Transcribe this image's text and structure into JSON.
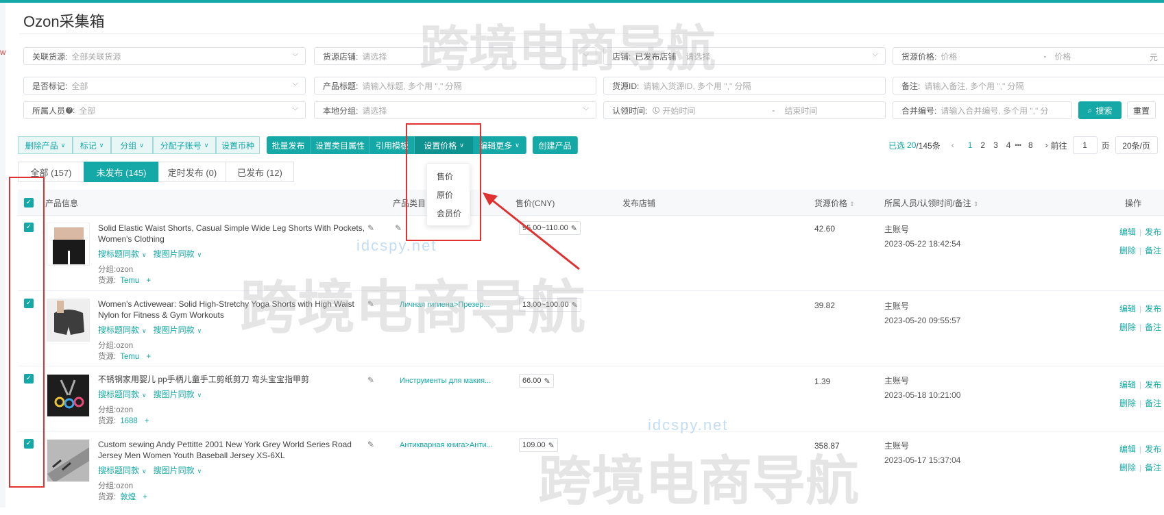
{
  "app": {
    "title": "Ozon采集箱",
    "side_mark": "W"
  },
  "filters": {
    "row1": {
      "linked_source": {
        "label": "关联货源:",
        "value": "全部关联货源"
      },
      "source_shop": {
        "label": "货源店铺:",
        "placeholder": "请选择"
      },
      "shop": {
        "label": "店铺:",
        "value": "已发布店铺",
        "placeholder": "请选择"
      },
      "source_price": {
        "label": "货源价格:",
        "min_placeholder": "价格",
        "sep": "-",
        "max_placeholder": "价格",
        "unit": "元"
      }
    },
    "row2": {
      "marked": {
        "label": "是否标记:",
        "value": "全部"
      },
      "product_title": {
        "label": "产品标题:",
        "placeholder": "请输入标题, 多个用 \",\" 分隔"
      },
      "source_id": {
        "label": "货源ID:",
        "placeholder": "请输入货源ID, 多个用 \",\" 分隔"
      },
      "remark": {
        "label": "备注:",
        "placeholder": "请输入备注, 多个用 \",\" 分隔"
      }
    },
    "row3": {
      "owner": {
        "label": "所属人员",
        "help": "?",
        "colon": ":",
        "value": "全部"
      },
      "local_group": {
        "label": "本地分组:",
        "placeholder": "请选择"
      },
      "claim_time": {
        "label": "认领时间:",
        "start_placeholder": "开始时间",
        "sep": "-",
        "end_placeholder": "结束时间"
      },
      "merge_no": {
        "label": "合并编号:",
        "placeholder": "请输入合并编号, 多个用 \",\" 分"
      }
    },
    "search_label": "搜索",
    "reset_label": "重置"
  },
  "toolbar": {
    "delete": "删除产品",
    "mark": "标记",
    "group": "分组",
    "assign": "分配子账号",
    "currency": "设置币种",
    "batch_publish": "批量发布",
    "set_category": "设置类目属性",
    "template": "引用模板",
    "set_price": "设置价格",
    "edit_more": "编辑更多",
    "create": "创建产品"
  },
  "pagination": {
    "selected_prefix": "已选",
    "selected": "20",
    "total": "/145条",
    "prev": "‹",
    "pages": [
      "1",
      "2",
      "3",
      "4"
    ],
    "ellipsis": "•••",
    "last": "8",
    "next": "›",
    "goto_label": "前往",
    "goto_value": "1",
    "page_unit": "页",
    "page_size": "20条/页"
  },
  "tabs": [
    {
      "label": "全部 (157)"
    },
    {
      "label": "未发布 (145)"
    },
    {
      "label": "定时发布 (0)"
    },
    {
      "label": "已发布 (12)"
    }
  ],
  "table": {
    "headers": {
      "product_info": "产品信息",
      "category": "产品类目",
      "price": "售价(CNY)",
      "shop": "发布店铺",
      "cost": "货源价格",
      "owner": "所属人员/认领时间/备注",
      "ops": "操作"
    },
    "links": {
      "title_same": "搜标题同款",
      "image_same": "搜图片同款"
    },
    "group_label": "分组:",
    "source_label": "货源:",
    "ops": {
      "edit": "编辑",
      "publish": "发布",
      "delete": "删除",
      "remark": "备注"
    },
    "rows": [
      {
        "title": "Solid Elastic Waist Shorts, Casual Simple Wide Leg Shorts With Pockets, Women's Clothing",
        "group": "ozon",
        "source": "Temu",
        "category": "",
        "price": "95.00~110.00",
        "cost": "42.60",
        "owner": "主账号",
        "time": "2023-05-22 18:42:54"
      },
      {
        "title": "Women's Activewear: Solid High-Stretchy Yoga Shorts with High Waist Nylon for Fitness & Gym Workouts",
        "group": "ozon",
        "source": "Temu",
        "category": "Личная гигиена>Презер...",
        "price": "13.00~100.00",
        "cost": "39.82",
        "owner": "主账号",
        "time": "2023-05-20 09:55:57"
      },
      {
        "title": "不锈钢家用婴儿 pp手柄儿童手工剪纸剪刀 弯头宝宝指甲剪",
        "group": "ozon",
        "source": "1688",
        "category": "Инструменты для макия...",
        "price": "66.00",
        "cost": "1.39",
        "owner": "主账号",
        "time": "2023-05-18 10:21:00"
      },
      {
        "title": "Custom sewing Andy Pettitte 2001 New York Grey World Series Road Jersey Men Women Youth Baseball Jersey XS-6XL",
        "group": "ozon",
        "source": "敦煌",
        "category": "Антикварная книга>Анти...",
        "price": "109.00",
        "cost": "358.87",
        "owner": "主账号",
        "time": "2023-05-17 15:37:04"
      }
    ]
  },
  "price_dropdown": {
    "items": [
      "售价",
      "原价",
      "会员价"
    ]
  },
  "watermark": {
    "text": "跨境电商导航",
    "domain": "idcspy.net"
  },
  "colors": {
    "accent": "#14a8a6",
    "annotation": "#e03030"
  }
}
